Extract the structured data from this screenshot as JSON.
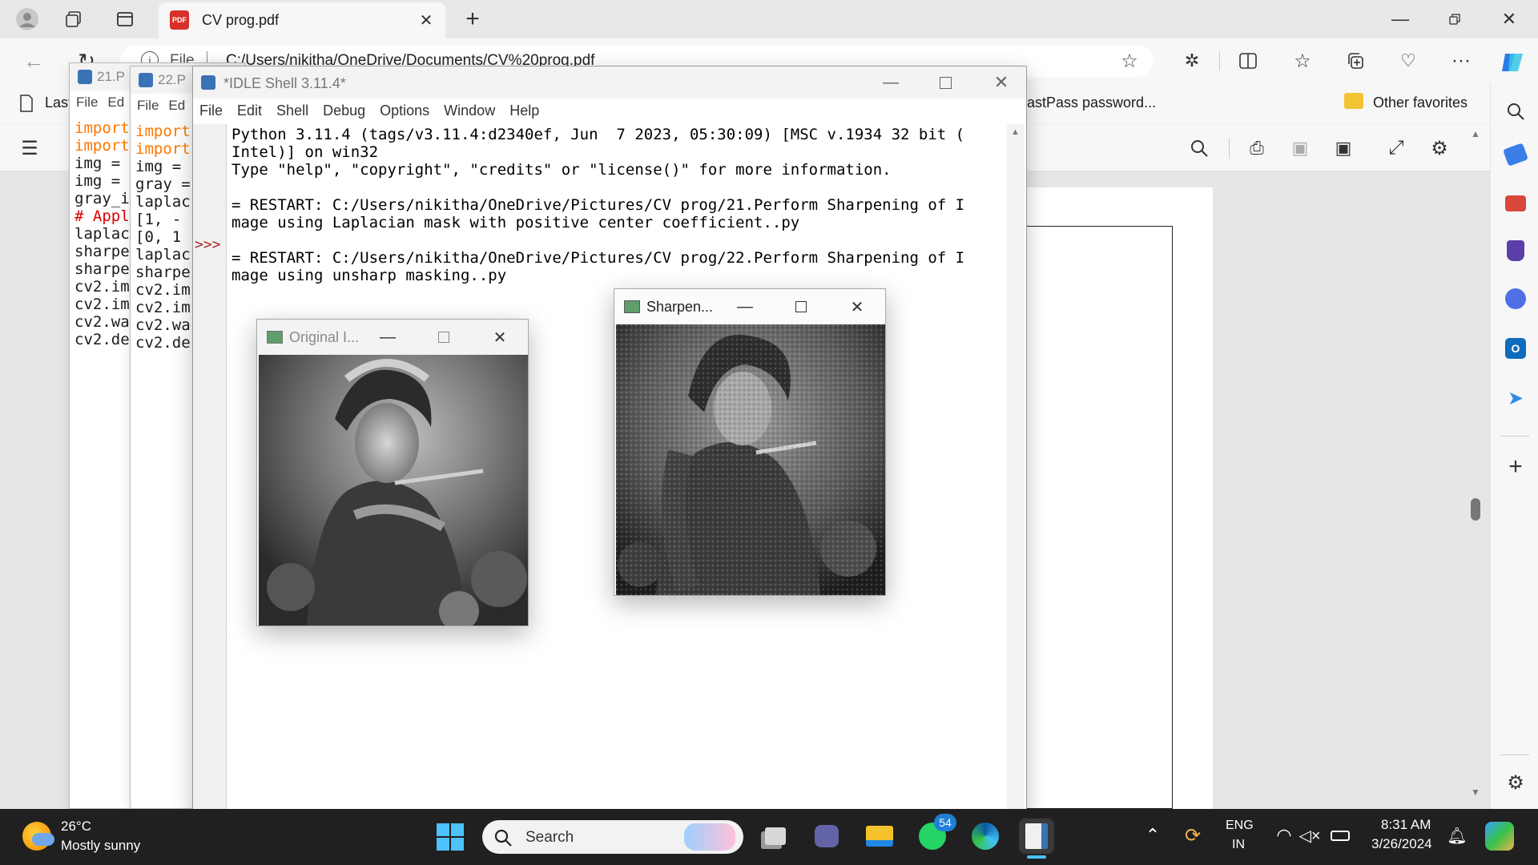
{
  "browser": {
    "tab_title": "CV prog.pdf",
    "url_scheme": "File",
    "url": "C:/Users/nikitha/OneDrive/Documents/CV%20prog.pdf",
    "favorites_left": "Last",
    "favorites_middle": "astPass password...",
    "other_favorites": "Other favorites"
  },
  "editor21": {
    "title": "21.P",
    "menu": [
      "File",
      "Ed"
    ],
    "lines": [
      {
        "t": "import",
        "c": "kw"
      },
      {
        "t": "import",
        "c": "kw"
      },
      {
        "t": "img = ",
        "c": ""
      },
      {
        "t": "img = ",
        "c": ""
      },
      {
        "t": "gray_i",
        "c": ""
      },
      {
        "t": "# Appl",
        "c": "cm"
      },
      {
        "t": "laplac",
        "c": ""
      },
      {
        "t": "sharpe",
        "c": ""
      },
      {
        "t": "sharpe",
        "c": ""
      },
      {
        "t": "cv2.im",
        "c": ""
      },
      {
        "t": "cv2.im",
        "c": ""
      },
      {
        "t": "cv2.wa",
        "c": ""
      },
      {
        "t": "cv2.de",
        "c": ""
      }
    ]
  },
  "editor22": {
    "title": "22.P",
    "menu": [
      "File",
      "Ed"
    ],
    "lines": [
      {
        "t": "import",
        "c": "kw"
      },
      {
        "t": "import",
        "c": "kw"
      },
      {
        "t": "img = ",
        "c": ""
      },
      {
        "t": "gray =",
        "c": ""
      },
      {
        "t": "laplac",
        "c": ""
      },
      {
        "t": " [1, -",
        "c": ""
      },
      {
        "t": " [0, 1",
        "c": ""
      },
      {
        "t": "laplac",
        "c": ""
      },
      {
        "t": "sharpe",
        "c": ""
      },
      {
        "t": "cv2.im",
        "c": ""
      },
      {
        "t": "cv2.im",
        "c": ""
      },
      {
        "t": "cv2.wa",
        "c": ""
      },
      {
        "t": "cv2.de",
        "c": ""
      }
    ]
  },
  "shell": {
    "title": "*IDLE Shell 3.11.4*",
    "menu": [
      "File",
      "Edit",
      "Shell",
      "Debug",
      "Options",
      "Window",
      "Help"
    ],
    "prompt": ">>>",
    "text": "Python 3.11.4 (tags/v3.11.4:d2340ef, Jun  7 2023, 05:30:09) [MSC v.1934 32 bit (\nIntel)] on win32\nType \"help\", \"copyright\", \"credits\" or \"license()\" for more information.\n\n= RESTART: C:/Users/nikitha/OneDrive/Pictures/CV prog/21.Perform Sharpening of I\nmage using Laplacian mask with positive center coefficient..py\n\n= RESTART: C:/Users/nikitha/OneDrive/Pictures/CV prog/22.Perform Sharpening of I\nmage using unsharp masking..py"
  },
  "original_window": {
    "title": "Original I..."
  },
  "sharpened_window": {
    "title": "Sharpen..."
  },
  "taskbar": {
    "temperature": "26°C",
    "weather": "Mostly sunny",
    "search_placeholder": "Search",
    "whatsapp_badge": "54",
    "language_top": "ENG",
    "language_bottom": "IN",
    "time": "8:31 AM",
    "date": "3/26/2024"
  },
  "colors": {
    "keyword": "#ff7700",
    "comment": "#dd0000",
    "prompt": "#b0232a",
    "taskbar": "#202020",
    "accent": "#0078d4"
  }
}
